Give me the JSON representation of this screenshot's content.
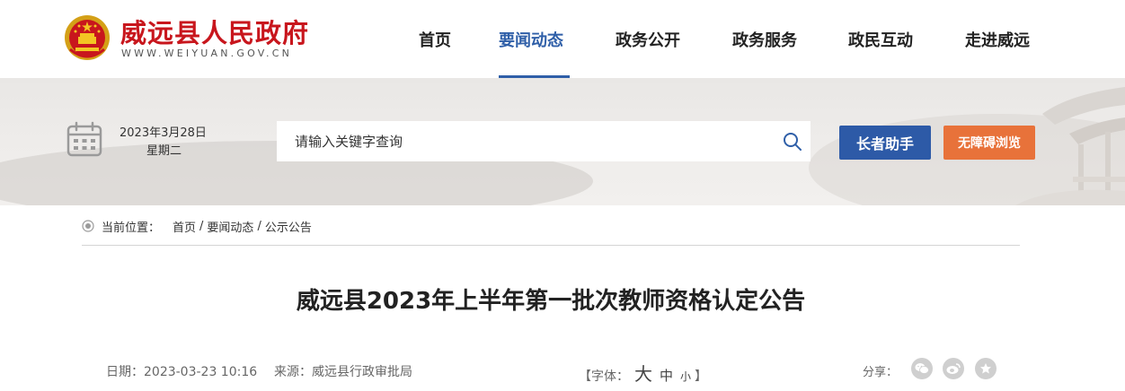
{
  "site": {
    "title": "威远县人民政府",
    "url": "WWW.WEIYUAN.GOV.CN",
    "emblem_icon": "national-emblem-icon"
  },
  "nav": {
    "items": [
      {
        "label": "首页"
      },
      {
        "label": "要闻动态"
      },
      {
        "label": "政务公开"
      },
      {
        "label": "政务服务"
      },
      {
        "label": "政民互动"
      },
      {
        "label": "走进威远"
      }
    ],
    "active": "要闻动态"
  },
  "banner": {
    "date": "2023年3月28日",
    "weekday": "星期二",
    "search_placeholder": "请输入关键字查询",
    "elder_button": "长者助手",
    "accessibility_button": "无障碍浏览"
  },
  "breadcrumb": {
    "label": "当前位置：",
    "items": [
      "首页",
      "要闻动态",
      "公示公告"
    ],
    "separator": "/"
  },
  "article": {
    "title": "威远县2023年上半年第一批次教师资格认定公告",
    "date": "日期：2023-03-23 10:16",
    "source": "来源：威远县行政审批局",
    "font_label_open": "【字体：",
    "font_large": "大",
    "font_medium": "中",
    "font_small": "小",
    "font_label_close": "】",
    "share_label": "分享："
  },
  "colors": {
    "brand_red": "#c8161d",
    "nav_active": "#2f5fa8",
    "elder_button_bg": "#2d5aa7",
    "access_button_bg": "#e8723a"
  }
}
